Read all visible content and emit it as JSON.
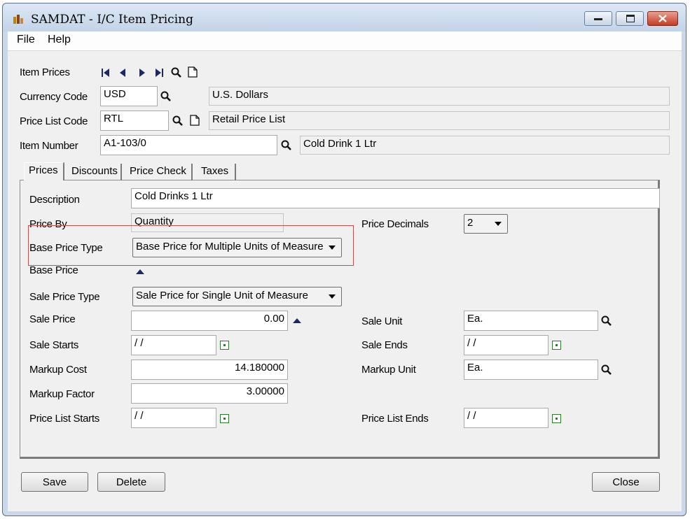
{
  "window": {
    "title": "SAMDAT - I/C Item Pricing"
  },
  "menu": {
    "file": "File",
    "help": "Help"
  },
  "header": {
    "item_prices_label": "Item Prices",
    "currency_code_label": "Currency Code",
    "currency_code": "USD",
    "currency_desc": "U.S. Dollars",
    "price_list_code_label": "Price List Code",
    "price_list_code": "RTL",
    "price_list_desc": "Retail Price List",
    "item_number_label": "Item Number",
    "item_number": "A1-103/0",
    "item_desc": "Cold Drink 1 Ltr"
  },
  "tabs": [
    {
      "label": "Prices",
      "active": true
    },
    {
      "label": "Discounts"
    },
    {
      "label": "Price Check"
    },
    {
      "label": "Taxes"
    }
  ],
  "prices": {
    "description_label": "Description",
    "description": "Cold Drinks 1 Ltr",
    "price_by_label": "Price By",
    "price_by": "Quantity",
    "price_decimals_label": "Price Decimals",
    "price_decimals": "2",
    "base_price_type_label": "Base Price Type",
    "base_price_type": "Base Price for Multiple Units of Measure",
    "base_price_label": "Base Price",
    "sale_price_type_label": "Sale Price Type",
    "sale_price_type": "Sale Price for Single Unit of Measure",
    "sale_price_label": "Sale Price",
    "sale_price": "0.00",
    "sale_unit_label": "Sale Unit",
    "sale_unit": "Ea.",
    "sale_starts_label": "Sale Starts",
    "sale_starts": "/ /",
    "sale_ends_label": "Sale Ends",
    "sale_ends": "/ /",
    "markup_cost_label": "Markup Cost",
    "markup_cost": "14.180000",
    "markup_unit_label": "Markup Unit",
    "markup_unit": "Ea.",
    "markup_factor_label": "Markup Factor",
    "markup_factor": "3.00000",
    "price_list_starts_label": "Price List Starts",
    "price_list_starts": "/ /",
    "price_list_ends_label": "Price List Ends",
    "price_list_ends": "/ /"
  },
  "buttons": {
    "save": "Save",
    "delete": "Delete",
    "close": "Close"
  },
  "colors": {
    "highlight": "#c0504d",
    "title_bg": "#c9d8ea"
  }
}
